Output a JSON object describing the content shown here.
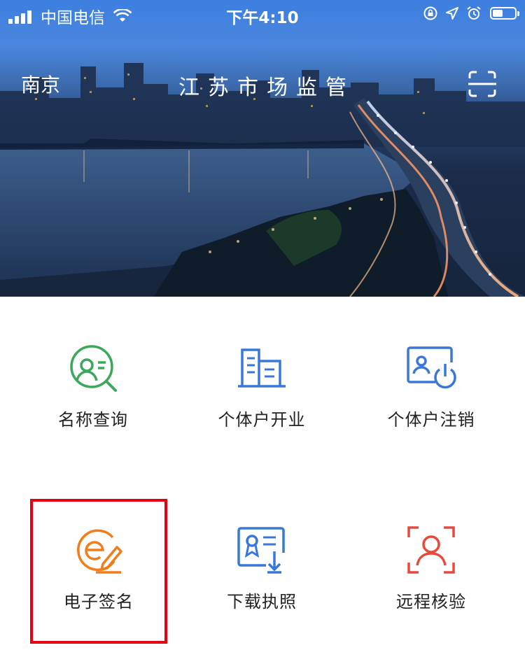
{
  "status_bar": {
    "carrier": "中国电信",
    "time": "下午4:10"
  },
  "header": {
    "city": "南京",
    "title": "江苏市场监管",
    "scan_icon": "scan-icon"
  },
  "services": [
    {
      "label": "名称查询",
      "icon": "name-search-icon",
      "color": "#3aa85a"
    },
    {
      "label": "个体户开业",
      "icon": "building-icon",
      "color": "#3a78d8"
    },
    {
      "label": "个体户注销",
      "icon": "cancel-power-icon",
      "color": "#3a78d8"
    },
    {
      "label": "电子签名",
      "icon": "e-signature-icon",
      "color": "#f07d18",
      "highlighted": true
    },
    {
      "label": "下载执照",
      "icon": "license-download-icon",
      "color": "#3a78d8"
    },
    {
      "label": "远程核验",
      "icon": "face-verify-icon",
      "color": "#e54a3c"
    }
  ],
  "highlight_color": "#e60012"
}
